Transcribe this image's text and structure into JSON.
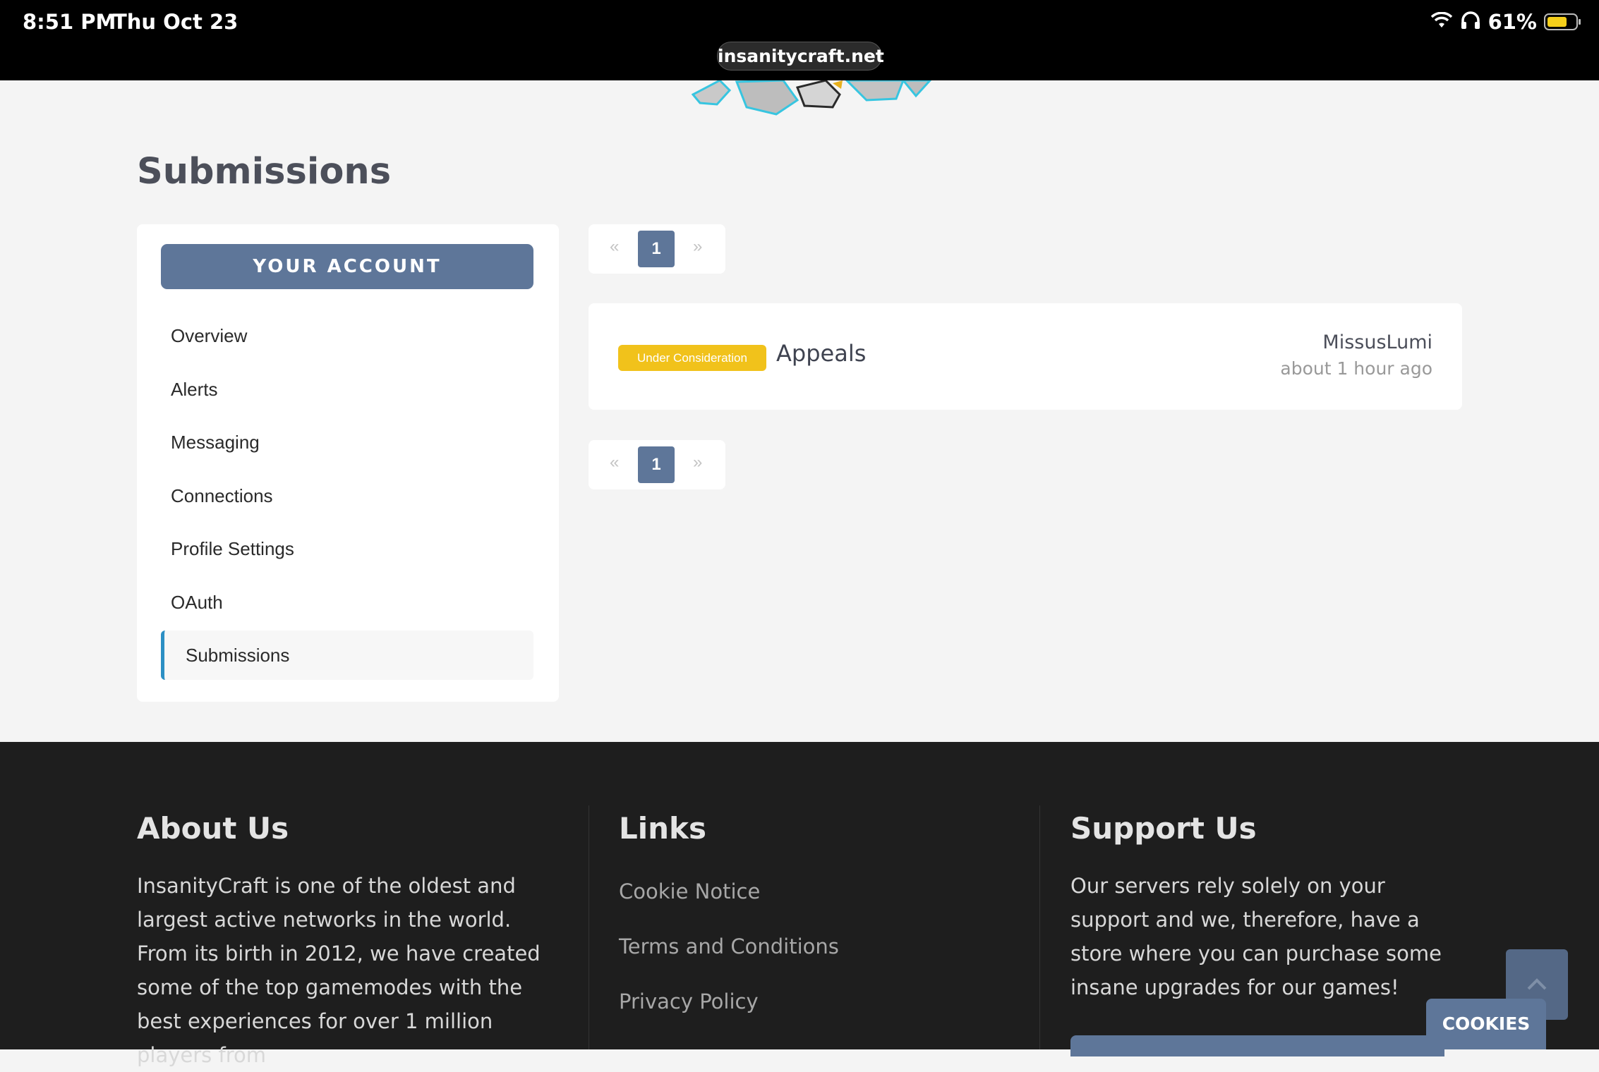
{
  "status_bar": {
    "time": "8:51 PM",
    "date": "Thu Oct 23",
    "url": "insanitycraft.net",
    "battery": "61%",
    "battery_level": 0.61
  },
  "page": {
    "title": "Submissions"
  },
  "sidebar": {
    "header": "YOUR ACCOUNT",
    "items": [
      {
        "label": "Overview"
      },
      {
        "label": "Alerts"
      },
      {
        "label": "Messaging"
      },
      {
        "label": "Connections"
      },
      {
        "label": "Profile Settings"
      },
      {
        "label": "OAuth"
      },
      {
        "label": "Submissions",
        "active": true
      }
    ]
  },
  "pagination": {
    "prev": "«",
    "current": "1",
    "next": "»"
  },
  "submissions": [
    {
      "status": "Under Consideration",
      "title": "Appeals",
      "user": "MissusLumi",
      "time": "about 1 hour ago"
    }
  ],
  "footer": {
    "about": {
      "title": "About Us",
      "text": "InsanityCraft is one of the oldest and largest active networks in the world. From its birth in 2012, we have created some of the top gamemodes with the best experiences for over 1 million players from"
    },
    "links": {
      "title": "Links",
      "items": [
        "Cookie Notice",
        "Terms and Conditions",
        "Privacy Policy"
      ]
    },
    "support": {
      "title": "Support Us",
      "text": "Our servers rely solely on your support and we, therefore, have a store where you can purchase some insane upgrades for our games!"
    }
  },
  "cookies_label": "COOKIES",
  "colors": {
    "accent": "#5e7699",
    "badge": "#f1c21b",
    "active_border": "#2b8fc4",
    "footer_bg": "#1e1e1e"
  }
}
